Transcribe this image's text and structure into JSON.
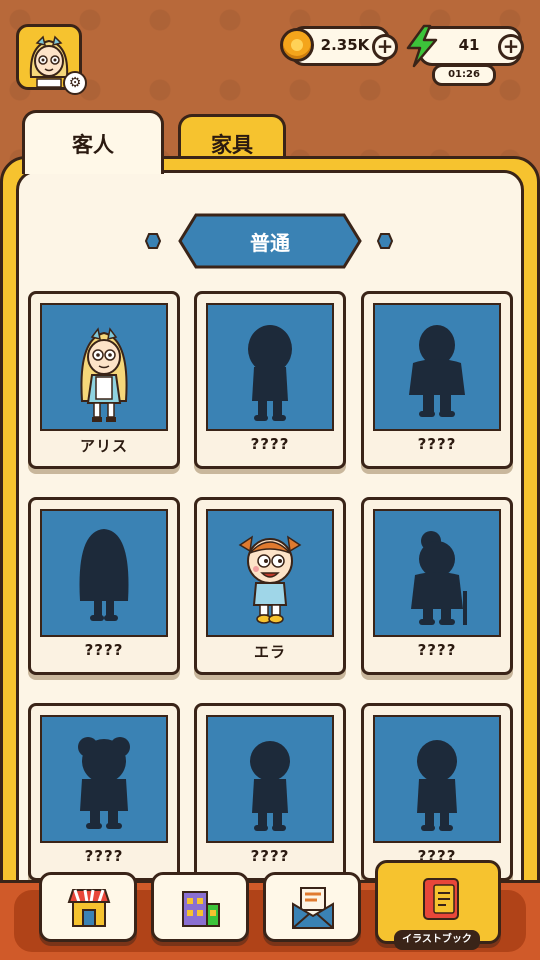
{
  "header": {
    "coins": "2.35K",
    "energy": "41",
    "energy_timer": "01:26"
  },
  "tabs": [
    {
      "label": "客人",
      "active": true
    },
    {
      "label": "家具",
      "active": false
    }
  ],
  "section": {
    "title": "普通"
  },
  "cards": [
    {
      "label": "アリス",
      "unlocked": true
    },
    {
      "label": "????",
      "unlocked": false
    },
    {
      "label": "????",
      "unlocked": false
    },
    {
      "label": "????",
      "unlocked": false
    },
    {
      "label": "エラ",
      "unlocked": true
    },
    {
      "label": "????",
      "unlocked": false
    },
    {
      "label": "????",
      "unlocked": false
    },
    {
      "label": "????",
      "unlocked": false
    },
    {
      "label": "????",
      "unlocked": false
    }
  ],
  "bottom_nav": {
    "active_label": "イラストブック",
    "items": [
      "shop-icon",
      "building-icon",
      "mail-icon",
      "book-icon"
    ]
  },
  "colors": {
    "background": "#b8693a",
    "panel_yellow": "#f6c32f",
    "card_blue": "#3a82b4",
    "banner_blue": "#3a82b4",
    "silhouette": "#1d2a3a",
    "outline": "#3a2418"
  }
}
